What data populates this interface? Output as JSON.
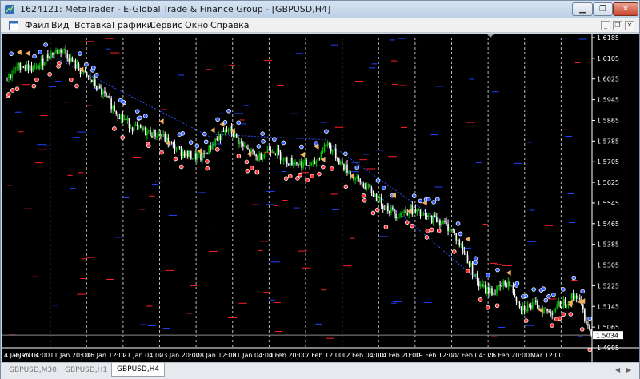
{
  "window": {
    "title": "1624121: MetaTrader - E-Global Trade & Finance Group - [GBPUSD,H4]"
  },
  "menu": {
    "items": [
      "Файл",
      "Вид",
      "Вставка",
      "Графики",
      "Сервис",
      "Окно",
      "Справка"
    ]
  },
  "tabs": [
    {
      "label": "GBPUSD,M30",
      "active": false
    },
    {
      "label": "GBPUSD,H1",
      "active": false
    },
    {
      "label": "GBPUSD,H4",
      "active": true
    }
  ],
  "colors": {
    "background": "#000000",
    "bull_candle": "#00c000",
    "bear_candle": "#ffffff",
    "price_label_bg": "#ffffff",
    "red_level": "#ff2020",
    "blue_level": "#2040ff"
  },
  "chart_data": {
    "type": "candlestick",
    "symbol": "GBPUSD",
    "timeframe": "H4",
    "current_price": "1.5034",
    "ylim": [
      1.4985,
      1.6185
    ],
    "y_ticks": [
      "1.6185",
      "1.6105",
      "1.6025",
      "1.5945",
      "1.5865",
      "1.5785",
      "1.5705",
      "1.5625",
      "1.5545",
      "1.5465",
      "1.5385",
      "1.5305",
      "1.5225",
      "1.5145",
      "1.5065",
      "1.4985"
    ],
    "x_ticks": [
      "4 Jan 2013",
      "9 Jan 04:00",
      "11 Jan 20:00",
      "16 Jan 12:00",
      "21 Jan 04:00",
      "23 Jan 20:00",
      "28 Jan 12:00",
      "31 Jan 04:00",
      "4 Feb 20:00",
      "7 Feb 12:00",
      "12 Feb 04:00",
      "14 Feb 20:00",
      "19 Feb 12:00",
      "22 Feb 04:00",
      "26 Feb 20:00",
      "1 Mar 12:00"
    ],
    "path": [
      [
        0,
        1.603
      ],
      [
        2,
        1.608
      ],
      [
        4,
        1.606
      ],
      [
        6,
        1.612
      ],
      [
        8,
        1.614
      ],
      [
        10,
        1.607
      ],
      [
        12,
        1.602
      ],
      [
        14,
        1.596
      ],
      [
        16,
        1.589
      ],
      [
        18,
        1.584
      ],
      [
        20,
        1.582
      ],
      [
        22,
        1.581
      ],
      [
        24,
        1.576
      ],
      [
        26,
        1.573
      ],
      [
        28,
        1.572
      ],
      [
        30,
        1.579
      ],
      [
        32,
        1.583
      ],
      [
        34,
        1.576
      ],
      [
        36,
        1.572
      ],
      [
        38,
        1.576
      ],
      [
        40,
        1.571
      ],
      [
        42,
        1.57
      ],
      [
        44,
        1.569
      ],
      [
        46,
        1.578
      ],
      [
        48,
        1.57
      ],
      [
        50,
        1.564
      ],
      [
        52,
        1.56
      ],
      [
        54,
        1.554
      ],
      [
        56,
        1.55
      ],
      [
        58,
        1.552
      ],
      [
        60,
        1.549
      ],
      [
        62,
        1.548
      ],
      [
        64,
        1.544
      ],
      [
        66,
        1.534
      ],
      [
        68,
        1.522
      ],
      [
        70,
        1.52
      ],
      [
        72,
        1.524
      ],
      [
        74,
        1.514
      ],
      [
        76,
        1.515
      ],
      [
        78,
        1.512
      ],
      [
        80,
        1.516
      ],
      [
        82,
        1.519
      ],
      [
        84,
        1.5034
      ]
    ]
  }
}
